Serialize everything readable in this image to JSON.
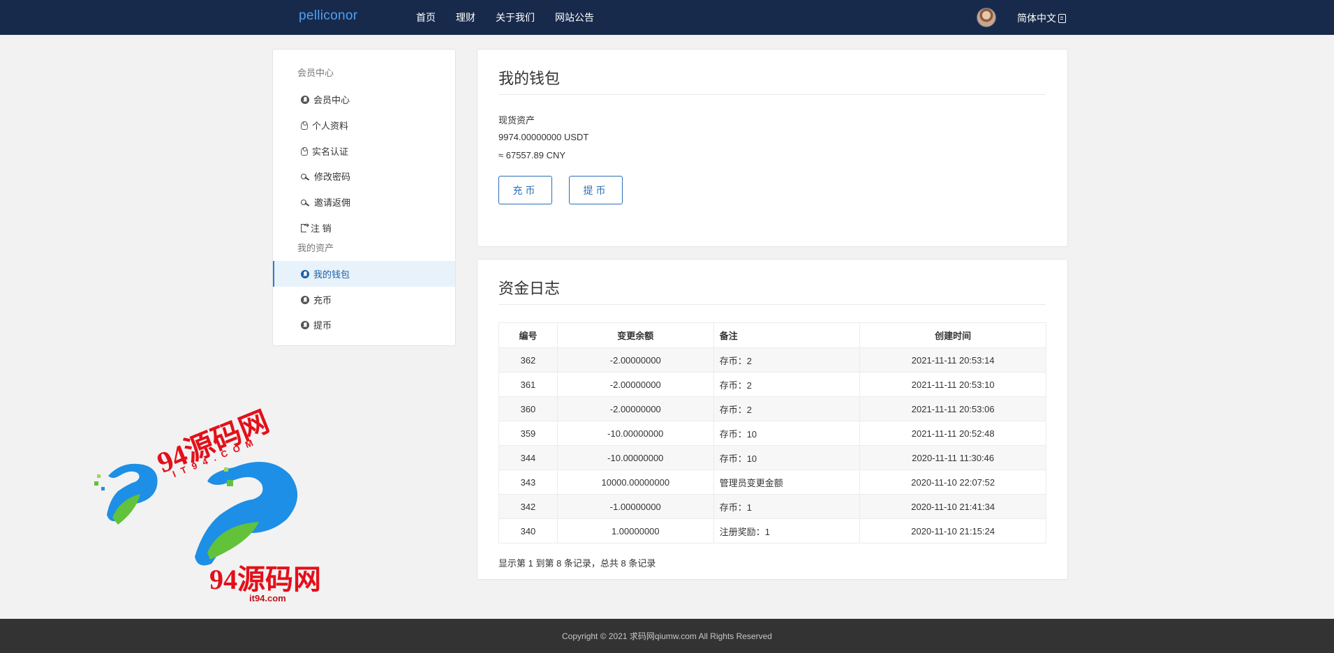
{
  "brand": "pelliconor",
  "nav": [
    "首页",
    "理财",
    "关于我们",
    "网站公告"
  ],
  "language": "简体中文",
  "sidebar": {
    "section1_title": "会员中心",
    "section1_items": [
      {
        "label": "会员中心",
        "icon": "user-circle-icon"
      },
      {
        "label": "个人资料",
        "icon": "person-icon"
      },
      {
        "label": "实名认证",
        "icon": "person-icon"
      },
      {
        "label": "修改密码",
        "icon": "key-icon"
      },
      {
        "label": "邀请返佣",
        "icon": "key-icon"
      },
      {
        "label": "注 销",
        "icon": "logout-icon"
      }
    ],
    "section2_title": "我的资产",
    "section2_items": [
      {
        "label": "我的钱包",
        "icon": "user-circle-icon",
        "active": true
      },
      {
        "label": "充币",
        "icon": "user-circle-icon"
      },
      {
        "label": "提币",
        "icon": "user-circle-icon"
      }
    ]
  },
  "wallet": {
    "title": "我的钱包",
    "asset_label": "现货资产",
    "usdt_balance": "9974.00000000 USDT",
    "cny_estimate": "≈ 67557.89 CNY",
    "deposit_button": "充币",
    "withdraw_button": "提币"
  },
  "log": {
    "title": "资金日志",
    "columns": [
      "编号",
      "变更余额",
      "备注",
      "创建时间"
    ],
    "rows": [
      [
        "362",
        "-2.00000000",
        "存币：2",
        "2021-11-11 20:53:14"
      ],
      [
        "361",
        "-2.00000000",
        "存币：2",
        "2021-11-11 20:53:10"
      ],
      [
        "360",
        "-2.00000000",
        "存币：2",
        "2021-11-11 20:53:06"
      ],
      [
        "359",
        "-10.00000000",
        "存币：10",
        "2021-11-11 20:52:48"
      ],
      [
        "344",
        "-10.00000000",
        "存币：10",
        "2020-11-11 11:30:46"
      ],
      [
        "343",
        "10000.00000000",
        "管理员变更金额",
        "2020-11-10 22:07:52"
      ],
      [
        "342",
        "-1.00000000",
        "存币：1",
        "2020-11-10 21:41:34"
      ],
      [
        "340",
        "1.00000000",
        "注册奖励：1",
        "2020-11-10 21:15:24"
      ]
    ],
    "summary": "显示第 1 到第 8 条记录，总共 8 条记录"
  },
  "watermark": {
    "title_top": "94源码网",
    "domain_arc": "IT94.COM",
    "title_bottom": "94源码网",
    "domain": "it94.com"
  },
  "footer": "Copyright © 2021 求码网qiumw.com All Rights Reserved",
  "colors": {
    "topbar": "#182a4b",
    "brand": "#4ea1f5",
    "accent": "#2b6db8",
    "footer": "#333333",
    "watermark_red": "#e3101a"
  }
}
